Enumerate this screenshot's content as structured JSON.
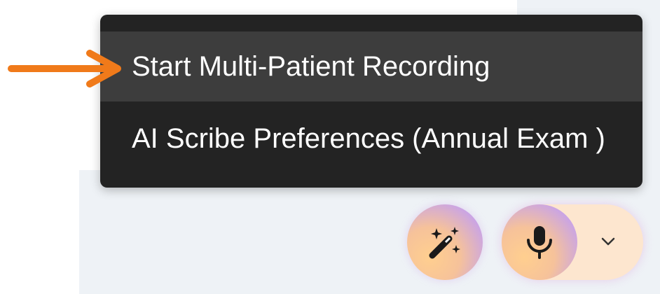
{
  "menu": {
    "items": [
      {
        "label": "Start Multi-Patient Recording",
        "highlighted": true
      },
      {
        "label": "AI Scribe Preferences (Annual Exam )",
        "highlighted": false
      }
    ]
  },
  "controls": {
    "wand_icon": "magic-wand-icon",
    "mic_icon": "microphone-icon",
    "dropdown_icon": "chevron-down-icon"
  },
  "annotation": {
    "arrow_color": "#f07a1a"
  },
  "colors": {
    "menu_background": "#232323",
    "menu_highlight": "#3d3d3d",
    "menu_text": "#ffffff",
    "page_background": "#eef2f6",
    "pill_background": "#fde6cf"
  }
}
